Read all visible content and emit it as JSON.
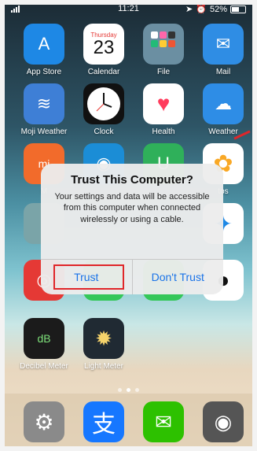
{
  "status_bar": {
    "time": "11:21",
    "battery": "52%"
  },
  "apps_row1": [
    {
      "label": "App Store",
      "icon": "app-store-icon",
      "color": "#1e88e5",
      "glyph": "A"
    },
    {
      "label": "Calendar",
      "icon": "calendar-icon",
      "color": "#ffffff",
      "glyph": ""
    },
    {
      "label": "File",
      "icon": "folder-icon",
      "color": "#6b8fa2",
      "glyph": ""
    },
    {
      "label": "Mail",
      "icon": "mail-icon",
      "color": "#2f8de4",
      "glyph": "✉"
    }
  ],
  "calendar": {
    "weekday": "Thursday",
    "day": "23"
  },
  "apps_row2": [
    {
      "label": "Moji Weather",
      "icon": "moji-weather-icon",
      "color": "#3e7fd6",
      "glyph": "≋"
    },
    {
      "label": "Clock",
      "icon": "clock-icon",
      "color": "#111111",
      "glyph": "◷"
    },
    {
      "label": "Health",
      "icon": "health-icon",
      "color": "#ffffff",
      "glyph": "♥"
    },
    {
      "label": "Weather",
      "icon": "weather-icon",
      "color": "#2e8de6",
      "glyph": "☁"
    }
  ],
  "apps_row3": [
    {
      "label": "M",
      "icon": "mi-home-icon",
      "color": "#f26b2b",
      "glyph": "mi"
    },
    {
      "label": "",
      "icon": "wifi-icon",
      "color": "#1b8dd6",
      "glyph": "◉"
    },
    {
      "label": "",
      "icon": "mi-jia-icon",
      "color": "#2fb05a",
      "glyph": "U"
    },
    {
      "label": "tos",
      "icon": "photos-icon",
      "color": "#ffffff",
      "glyph": "✿"
    }
  ],
  "apps_row5": [
    {
      "label": "Decibel Meter",
      "icon": "decibel-meter-icon",
      "color": "#1b1b1b",
      "glyph": "dB"
    },
    {
      "label": "Light Meter",
      "icon": "light-meter-icon",
      "color": "#202a33",
      "glyph": "✹"
    }
  ],
  "dock": [
    {
      "icon": "settings-icon",
      "color": "#8a8a8a",
      "glyph": "⚙"
    },
    {
      "icon": "alipay-icon",
      "color": "#1677ff",
      "glyph": "支"
    },
    {
      "icon": "wechat-icon",
      "color": "#2dc100",
      "glyph": "✉"
    },
    {
      "icon": "camera-icon",
      "color": "#555555",
      "glyph": "◉"
    }
  ],
  "dialog": {
    "title": "Trust This Computer?",
    "message": "Your settings and data will be accessible from this computer when connected wirelessly or using a cable.",
    "trust_label": "Trust",
    "dont_trust_label": "Don't Trust"
  }
}
